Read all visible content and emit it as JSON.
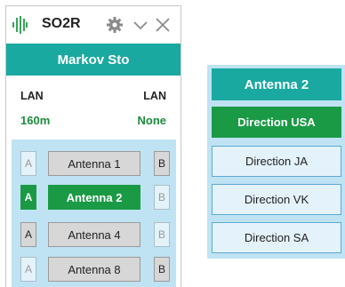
{
  "window": {
    "title": "SO2R",
    "station": "Markov Sto",
    "lan": {
      "left_label": "LAN",
      "right_label": "LAN",
      "left_value": "160m",
      "right_value": "None"
    },
    "antennas": [
      {
        "a_label": "A",
        "a_state": "dim",
        "label": "Antenna 1",
        "active": false,
        "b_label": "B",
        "b_state": "normal"
      },
      {
        "a_label": "A",
        "a_state": "on",
        "label": "Antenna 2",
        "active": true,
        "b_label": "B",
        "b_state": "dim"
      },
      {
        "a_label": "A",
        "a_state": "normal",
        "label": "Antenna 4",
        "active": false,
        "b_label": "B",
        "b_state": "dim"
      },
      {
        "a_label": "A",
        "a_state": "dim",
        "label": "Antenna 8",
        "active": false,
        "b_label": "B",
        "b_state": "normal"
      }
    ]
  },
  "popup": {
    "title": "Antenna 2",
    "directions": [
      {
        "label": "Direction USA",
        "active": true
      },
      {
        "label": "Direction JA",
        "active": false
      },
      {
        "label": "Direction VK",
        "active": false
      },
      {
        "label": "Direction SA",
        "active": false
      }
    ]
  },
  "icons": {
    "app": "waveform-icon",
    "settings": "gear-icon",
    "collapse": "chevron-down-icon",
    "close": "close-icon"
  },
  "colors": {
    "teal": "#1aa9a0",
    "green": "#1b9a46",
    "panel_blue": "#bfe3f3"
  }
}
